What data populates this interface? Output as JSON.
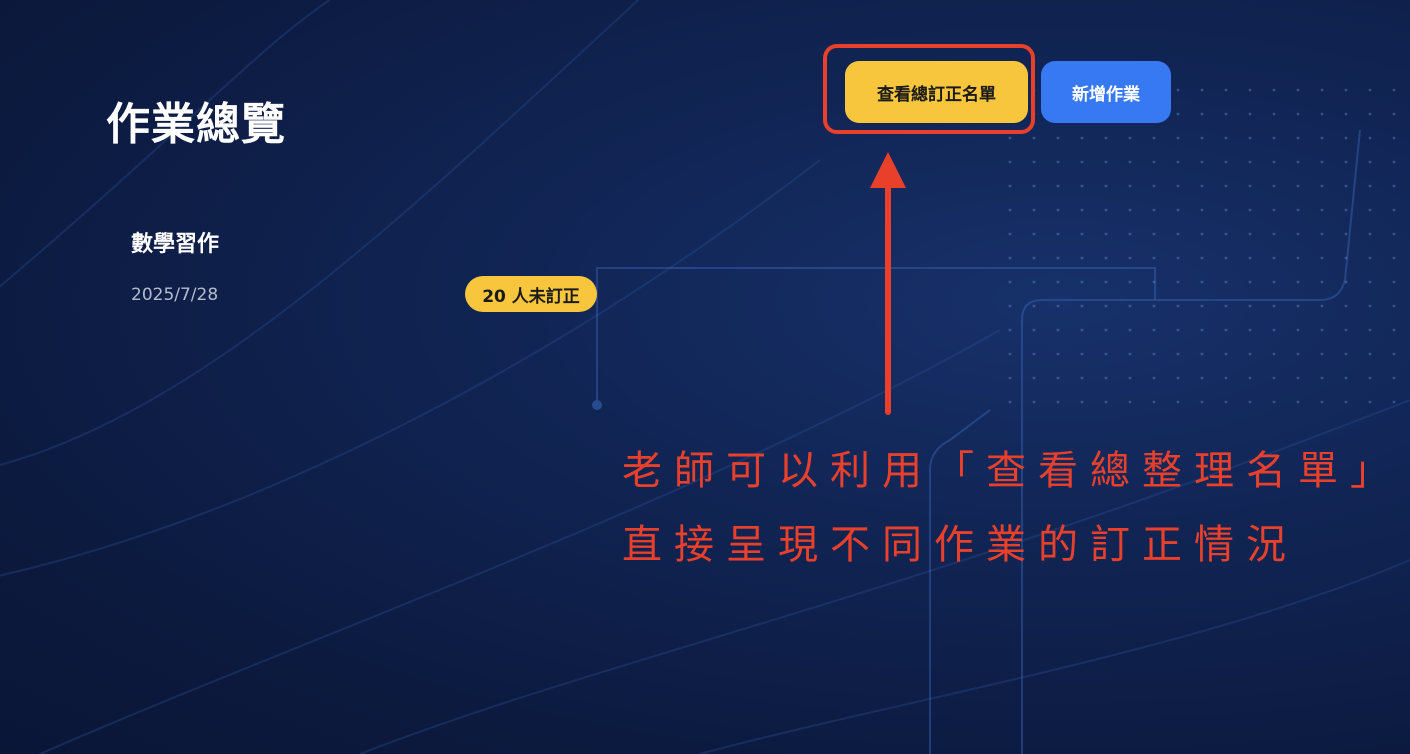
{
  "header": {
    "title": "作業總覽",
    "view_corrections_label": "查看總訂正名單",
    "add_assignment_label": "新增作業"
  },
  "assignments": [
    {
      "name": "數學習作",
      "date": "2025/7/28",
      "uncorrected_badge": "20 人未訂正"
    }
  ],
  "annotation": {
    "line1": "老師可以利用「查看總整理名單」",
    "line2": "直接呈現不同作業的訂正情況"
  },
  "colors": {
    "background": "#0d1b3d",
    "accent_yellow": "#f7c63d",
    "accent_blue": "#3779f2",
    "annotation_red": "#e8402a"
  },
  "icons": {
    "annotation_pointer": "arrow-up-icon"
  }
}
